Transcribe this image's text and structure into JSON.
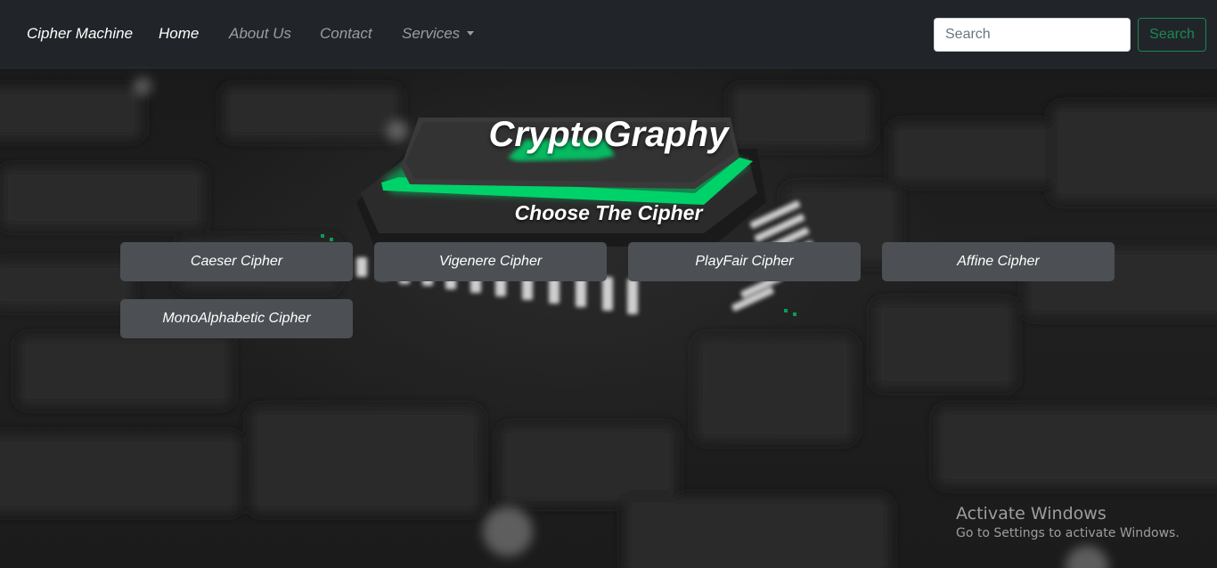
{
  "navbar": {
    "brand": "Cipher Machine",
    "links": [
      {
        "label": "Home"
      },
      {
        "label": "About Us"
      },
      {
        "label": "Contact"
      },
      {
        "label": "Services"
      }
    ],
    "search": {
      "placeholder": "Search",
      "value": "",
      "button_label": "Search"
    }
  },
  "hero": {
    "title": "CryptoGraphy",
    "subtitle": "Choose The Cipher",
    "ciphers": [
      {
        "label": "Caeser Cipher"
      },
      {
        "label": "Vigenere Cipher"
      },
      {
        "label": "PlayFair Cipher"
      },
      {
        "label": "Affine Cipher"
      },
      {
        "label": "MonoAlphabetic Cipher"
      }
    ]
  },
  "watermark": {
    "title": "Activate Windows",
    "subtitle": "Go to Settings to activate Windows."
  },
  "colors": {
    "navbar_bg": "#212529",
    "accent_green": "#198754",
    "chip_glow": "#00d26a",
    "button_bg": "#4c4f53"
  },
  "icons": [
    "caret-down-icon"
  ]
}
